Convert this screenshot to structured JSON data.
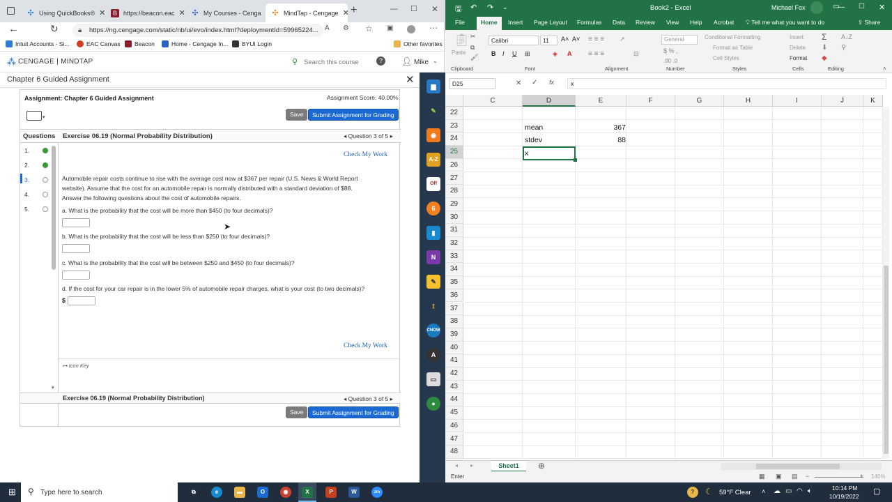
{
  "browser": {
    "tabs": [
      {
        "label": "Using QuickBooks®",
        "color": "#2e7bd6",
        "glyph": "✣"
      },
      {
        "label": "https://beacon.eac",
        "color": "#8b1a2b",
        "glyph": "B"
      },
      {
        "label": "My Courses - Cenga",
        "color": "#2c62c4",
        "glyph": "✣"
      },
      {
        "label": "MindTap - Cengage",
        "color": "#f08020",
        "glyph": "✣"
      }
    ],
    "url": "https://ng.cengage.com/static/nb/ui/evo/index.html?deploymentId=59965224...",
    "bookmarks": [
      {
        "label": "Intuit Accounts - Si...",
        "color": "#2e7bd6"
      },
      {
        "label": "EAC Canvas",
        "color": "#d04020"
      },
      {
        "label": "Beacon",
        "color": "#8b1a2b"
      },
      {
        "label": "Home - Cengage In...",
        "color": "#2c62c4"
      },
      {
        "label": "BYUI Login",
        "color": "#333"
      }
    ],
    "other_favorites": "Other favorites"
  },
  "cengage": {
    "brand": "CENGAGE | MINDTAP",
    "search_placeholder": "Search this course",
    "user": "Mike",
    "chapter_title": "Chapter 6 Guided Assignment",
    "assignment_label": "Assignment: Chapter 6 Guided Assignment",
    "score": "Assignment Score: 40.00%",
    "save": "Save",
    "submit": "Submit Assignment for Grading",
    "questions_header": "Questions",
    "exercise_title": "Exercise 06.19 (Normal Probability Distribution)",
    "question_nav": "Question 3 of 5",
    "check_work": "Check My Work",
    "questions": [
      {
        "num": "1.",
        "status": "correct"
      },
      {
        "num": "2.",
        "status": "correct"
      },
      {
        "num": "3.",
        "status": "current"
      },
      {
        "num": "4.",
        "status": "open"
      },
      {
        "num": "5.",
        "status": "open"
      }
    ],
    "intro_1": "Automobile repair costs continue to rise with the average cost now at $367 per repair (U.S. News & World Report",
    "intro_2": "website). Assume that the cost for an automobile repair is normally distributed with a standard deviation of $88.",
    "intro_3": "Answer the following questions about the cost of automobile repairs.",
    "qa": "a.  What is the probability that the cost will be more than $450 (to four decimals)?",
    "qb": "b.  What is the probability that the cost will be less than $250 (to four decimals)?",
    "qc": "c.  What is the probability that the cost will be between $250 and $450 (to four decimals)?",
    "qd": "d.  If the cost for your car repair is in the lower 5% of automobile repair charges, what is your cost (to two decimals)?",
    "dollar": "$",
    "icon_key": "Icon Key"
  },
  "excel": {
    "title": "Book2 - Excel",
    "user": "Michael Fox",
    "tabs": [
      "File",
      "Home",
      "Insert",
      "Page Layout",
      "Formulas",
      "Data",
      "Review",
      "View",
      "Help",
      "Acrobat"
    ],
    "tell_me": "Tell me what you want to do",
    "share": "Share",
    "font_name": "Calibri",
    "font_size": "11",
    "number_format": "General",
    "groups": [
      "Clipboard",
      "Font",
      "Alignment",
      "Number",
      "Styles",
      "Cells",
      "Editing"
    ],
    "styles_items": [
      "Conditional Formatting",
      "Format as Table",
      "Cell Styles"
    ],
    "cells_items": [
      "Insert",
      "Delete",
      "Format"
    ],
    "paste": "Paste",
    "name_box": "D25",
    "formula": "x",
    "columns": [
      "C",
      "D",
      "E",
      "F",
      "G",
      "H",
      "I",
      "J",
      "K"
    ],
    "rows": [
      "22",
      "23",
      "24",
      "25",
      "26",
      "27",
      "28",
      "29",
      "30",
      "31",
      "32",
      "33",
      "34",
      "35",
      "36",
      "37",
      "38",
      "39",
      "40",
      "41",
      "42",
      "43",
      "44",
      "45",
      "46",
      "47",
      "48"
    ],
    "cells": {
      "d23": "mean",
      "e23": "367",
      "d24": "stdev",
      "e24": "88",
      "d25": "x"
    },
    "sheet": "Sheet1",
    "status": "Enter",
    "zoom": "140%"
  },
  "taskbar": {
    "search_placeholder": "Type here to search",
    "weather": "59°F  Clear",
    "time": "10:14 PM",
    "date": "10/19/2022"
  }
}
